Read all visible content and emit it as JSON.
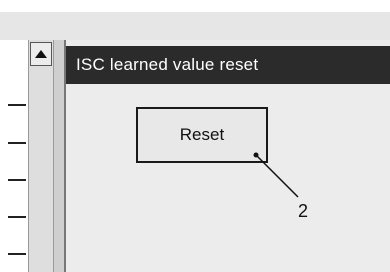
{
  "panel": {
    "title": "ISC learned value reset",
    "button_label": "Reset"
  },
  "annotation": {
    "callout_number": "2"
  },
  "icons": {
    "scroll_up": "triangle-up-icon"
  },
  "colors": {
    "title_bar_bg": "#2b2b2b",
    "title_bar_text": "#ffffff",
    "panel_bg": "#ececec"
  }
}
